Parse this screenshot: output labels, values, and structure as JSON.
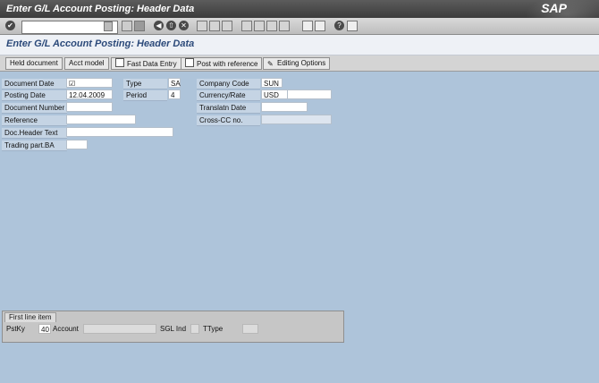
{
  "window": {
    "title": "Enter G/L Account Posting: Header Data",
    "brand": "SAP"
  },
  "screen": {
    "title": "Enter G/L Account Posting: Header Data"
  },
  "app_toolbar": {
    "held_document": "Held document",
    "acct_model": "Acct model",
    "fast_data_entry": "Fast Data Entry",
    "post_with_reference": "Post with reference",
    "editing_options": "Editing Options"
  },
  "fields": {
    "document_date": {
      "label": "Document Date",
      "value": "☑"
    },
    "posting_date": {
      "label": "Posting Date",
      "value": "12.04.2009"
    },
    "document_number": {
      "label": "Document Number",
      "value": ""
    },
    "reference": {
      "label": "Reference",
      "value": ""
    },
    "doc_header_text": {
      "label": "Doc.Header Text",
      "value": ""
    },
    "trading_part_ba": {
      "label": "Trading part.BA",
      "value": ""
    },
    "type": {
      "label": "Type",
      "value": "SA"
    },
    "period": {
      "label": "Period",
      "value": "4"
    },
    "company_code": {
      "label": "Company Code",
      "value": "SUN"
    },
    "currency_rate": {
      "label": "Currency/Rate",
      "value": "USD"
    },
    "translatn_date": {
      "label": "Translatn Date",
      "value": ""
    },
    "cross_cc_no": {
      "label": "Cross-CC no.",
      "value": ""
    }
  },
  "first_line_item": {
    "title": "First line item",
    "pstky_label": "PstKy",
    "pstky_value": "40",
    "account_label": "Account",
    "sgl_ind_label": "SGL Ind",
    "ttype_label": "TType"
  }
}
